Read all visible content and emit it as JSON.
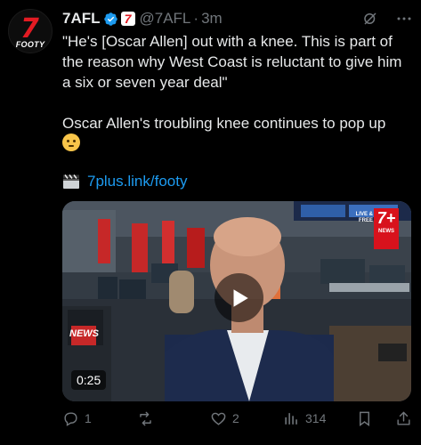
{
  "account": {
    "name": "7AFL",
    "handle": "@7AFL",
    "separator": "·",
    "time": "3m",
    "avatar_number": "7",
    "avatar_text": "FOOTY",
    "org_badge_text": "7"
  },
  "tweet": {
    "paragraph1": "\"He's [Oscar Allen] out with a knee. This is part of the reason why West Coast is reluctant to give him a six or seven year deal\"",
    "paragraph2": "Oscar Allen's troubling knee continues to pop up",
    "link": "7plus.link/footy"
  },
  "video": {
    "duration": "0:25",
    "live_badge_line1": "LIVE &",
    "live_badge_line2": "FREE",
    "brand_logo": "7+",
    "brand_sub": "NEWS",
    "desk_sign": "NEWS"
  },
  "actions": {
    "replies": "1",
    "reposts": "",
    "likes": "2",
    "views": "314"
  },
  "icons": {
    "verified": "verified-badge-icon",
    "grok": "grok-icon",
    "more": "more-icon",
    "reply": "reply-icon",
    "repost": "repost-icon",
    "like": "heart-icon",
    "views": "views-icon",
    "bookmark": "bookmark-icon",
    "share": "share-icon",
    "clapper": "clapper-board-icon",
    "play": "play-icon"
  },
  "colors": {
    "background": "#000000",
    "text": "#e7e9ea",
    "muted": "#71767b",
    "link": "#1d9bf0",
    "brand_red": "#e31b23"
  }
}
